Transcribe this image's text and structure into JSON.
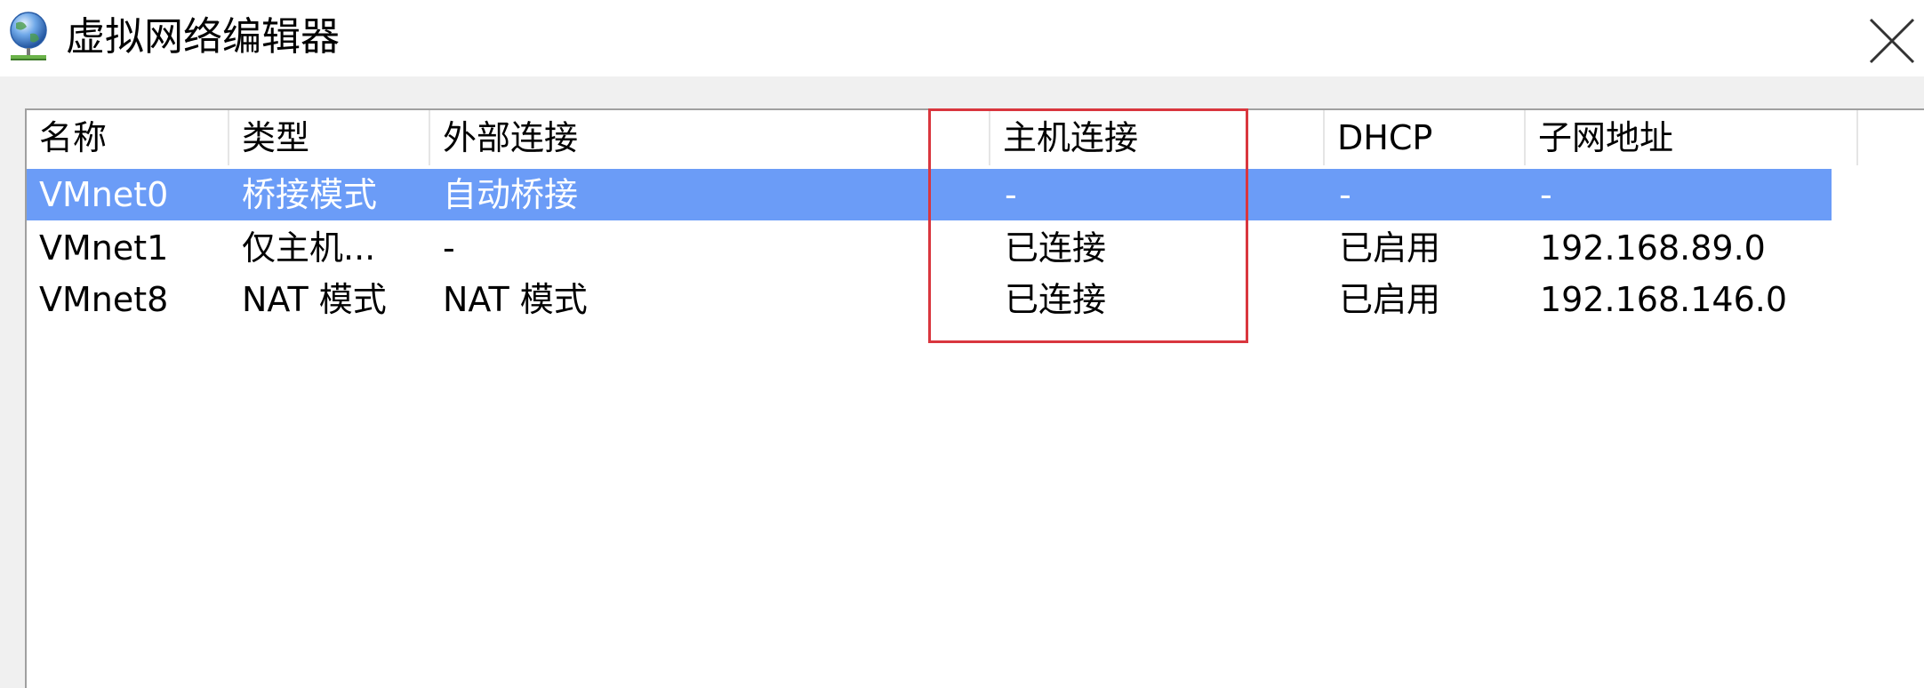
{
  "window": {
    "title": "虚拟网络编辑器",
    "icon": "network-globe-icon",
    "close_icon": "close-icon"
  },
  "table": {
    "columns": [
      {
        "key": "name",
        "label": "名称"
      },
      {
        "key": "type",
        "label": "类型"
      },
      {
        "key": "external",
        "label": "外部连接"
      },
      {
        "key": "host",
        "label": "主机连接"
      },
      {
        "key": "dhcp",
        "label": "DHCP"
      },
      {
        "key": "subnet",
        "label": "子网地址"
      }
    ],
    "rows": [
      {
        "name": "VMnet0",
        "type": "桥接模式",
        "external": "自动桥接",
        "host": "-",
        "dhcp": "-",
        "subnet": "-",
        "selected": true
      },
      {
        "name": "VMnet1",
        "type": "仅主机...",
        "external": "-",
        "host": "已连接",
        "dhcp": "已启用",
        "subnet": "192.168.89.0",
        "selected": false
      },
      {
        "name": "VMnet8",
        "type": "NAT 模式",
        "external": "NAT 模式",
        "host": "已连接",
        "dhcp": "已启用",
        "subnet": "192.168.146.0",
        "selected": false
      }
    ]
  },
  "colors": {
    "selection": "#6b9cf7",
    "annotation_box": "#d9363e"
  }
}
